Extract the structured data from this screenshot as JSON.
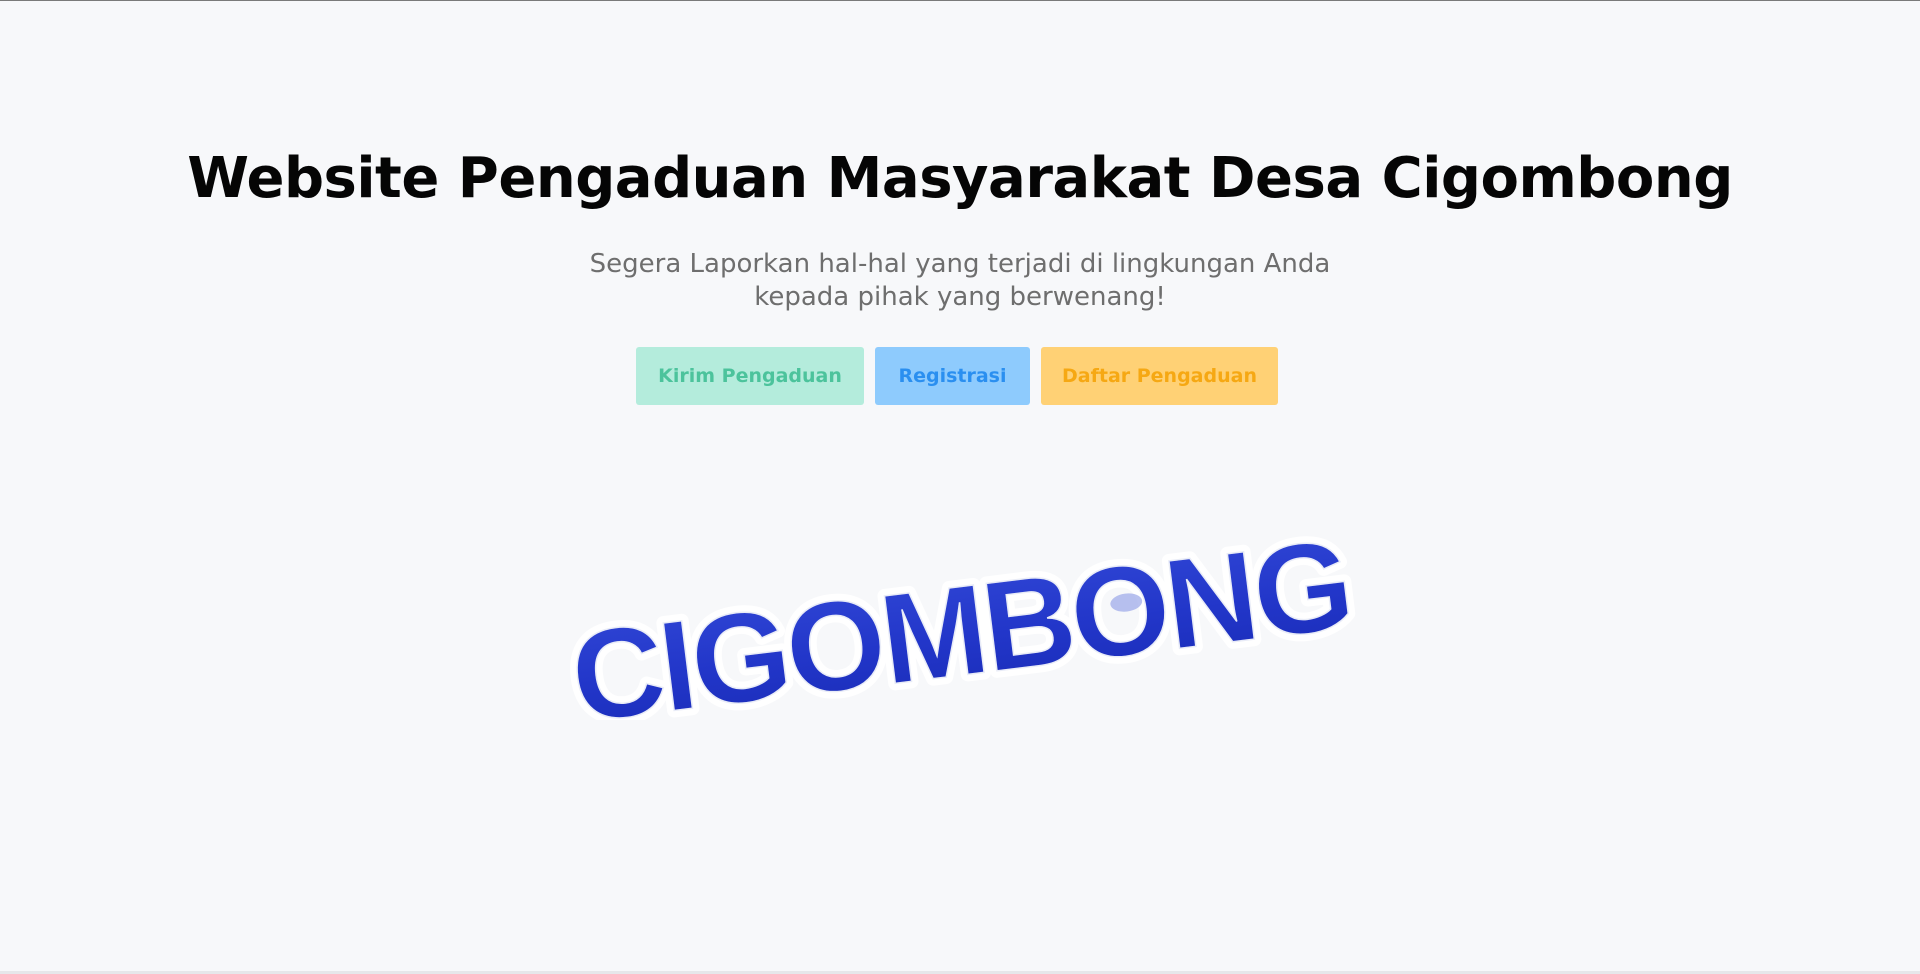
{
  "hero": {
    "title": "Website Pengaduan Masyarakat Desa Cigombong",
    "subtitle_line1": "Segera Laporkan hal-hal yang terjadi di lingkungan Anda",
    "subtitle_line2": "kepada pihak yang berwenang!"
  },
  "buttons": {
    "kirim": "Kirim Pengaduan",
    "registrasi": "Registrasi",
    "daftar": "Daftar Pengaduan"
  },
  "logo": {
    "text": "CIGOMBONG",
    "color": "#1f34c8",
    "outline": "#ffffff"
  },
  "colors": {
    "background": "#f7f8fa",
    "kirim_bg": "#b4ecdc",
    "registrasi_bg": "#8ecbfd",
    "daftar_bg": "#ffd175"
  }
}
